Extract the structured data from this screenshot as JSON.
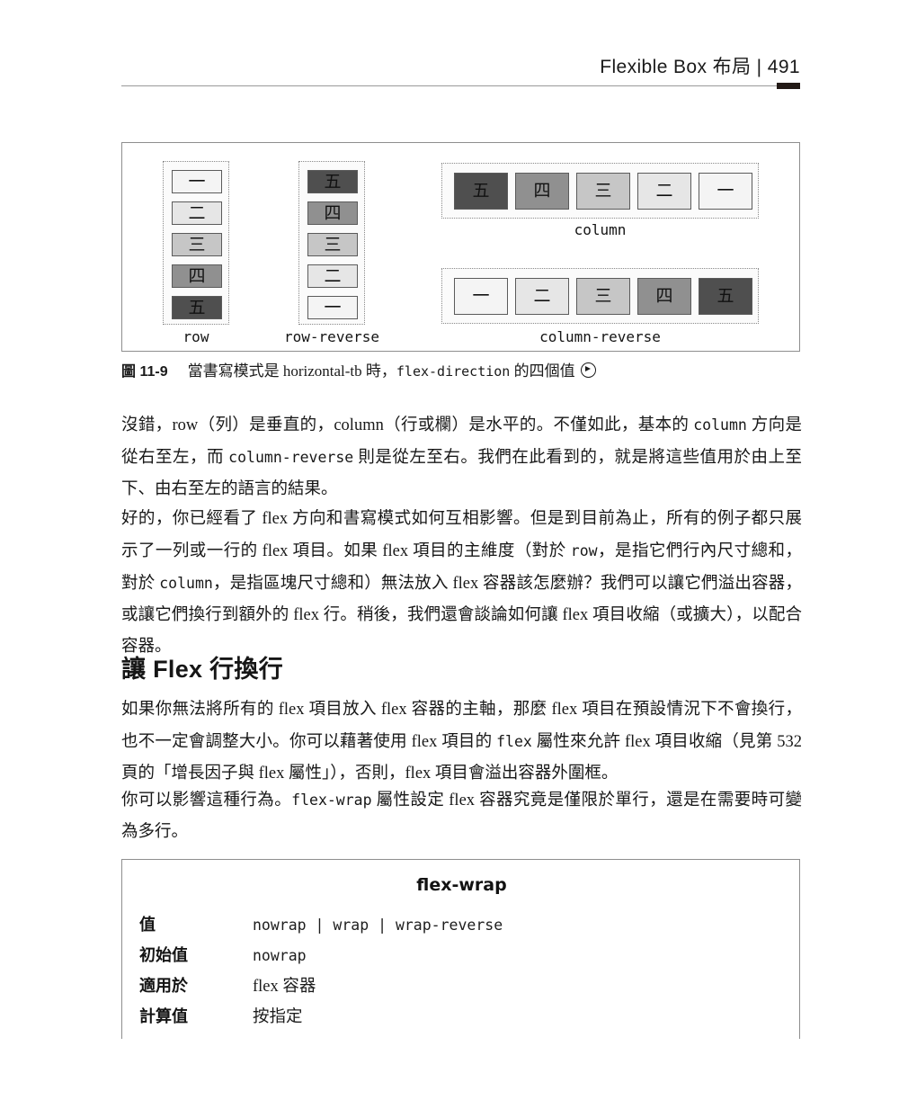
{
  "running_head": {
    "title": "Flexible Box 布局 | 491"
  },
  "figure": {
    "groups": [
      {
        "label": "row",
        "direction": "vertical",
        "items": [
          {
            "text": "一",
            "shade": "v1"
          },
          {
            "text": "二",
            "shade": "v2"
          },
          {
            "text": "三",
            "shade": "v3"
          },
          {
            "text": "四",
            "shade": "v4"
          },
          {
            "text": "五",
            "shade": "v5"
          }
        ]
      },
      {
        "label": "row-reverse",
        "direction": "vertical",
        "items": [
          {
            "text": "五",
            "shade": "v5"
          },
          {
            "text": "四",
            "shade": "v4"
          },
          {
            "text": "三",
            "shade": "v3"
          },
          {
            "text": "二",
            "shade": "v2"
          },
          {
            "text": "一",
            "shade": "v1"
          }
        ]
      },
      {
        "label": "column",
        "direction": "horizontal",
        "items": [
          {
            "text": "五",
            "shade": "v5"
          },
          {
            "text": "四",
            "shade": "v4"
          },
          {
            "text": "三",
            "shade": "v3"
          },
          {
            "text": "二",
            "shade": "v2"
          },
          {
            "text": "一",
            "shade": "v1"
          }
        ]
      },
      {
        "label": "column-reverse",
        "direction": "horizontal",
        "items": [
          {
            "text": "一",
            "shade": "v1"
          },
          {
            "text": "二",
            "shade": "v2"
          },
          {
            "text": "三",
            "shade": "v3"
          },
          {
            "text": "四",
            "shade": "v4"
          },
          {
            "text": "五",
            "shade": "v5"
          }
        ]
      }
    ],
    "shade_colors": {
      "v1": "#f4f4f4",
      "v2": "#e6e6e6",
      "v3": "#c6c6c6",
      "v4": "#909090",
      "v5": "#4f4f4f"
    }
  },
  "caption": {
    "number": "圖 11-9",
    "text_before": "當書寫模式是 horizontal-tb 時，",
    "code": "flex-direction",
    "text_after": " 的四個值",
    "icon": "play-circle-icon"
  },
  "paragraphs": {
    "p1_a": "沒錯，row（列）是垂直的，column（行或欄）是水平的。不僅如此，基本的 ",
    "p1_code1": "column",
    "p1_b": " 方向是從右至左，而 ",
    "p1_code2": "column-reverse",
    "p1_c": " 則是從左至右。我們在此看到的，就是將這些值用於由上至下、由右至左的語言的結果。",
    "p2_a": "好的，你已經看了 flex 方向和書寫模式如何互相影響。但是到目前為止，所有的例子都只展示了一列或一行的 flex 項目。如果 flex 項目的主維度（對於 ",
    "p2_code1": "row",
    "p2_b": "，是指它們行內尺寸總和，對於 ",
    "p2_code2": "column",
    "p2_c": "，是指區塊尺寸總和）無法放入 flex 容器該怎麼辦？我們可以讓它們溢出容器，或讓它們換行到額外的 flex 行。稍後，我們還會談論如何讓 flex 項目收縮（或擴大），以配合容器。",
    "p3_a": "如果你無法將所有的 flex 項目放入 flex 容器的主軸，那麼 flex 項目在預設情況下不會換行，也不一定會調整大小。你可以藉著使用 flex 項目的 ",
    "p3_code1": "flex",
    "p3_b": " 屬性來允許 flex 項目收縮（見第 532 頁的「增長因子與 flex 屬性」），否則，flex 項目會溢出容器外圍框。",
    "p4_a": "你可以影響這種行為。",
    "p4_code1": "flex-wrap",
    "p4_b": " 屬性設定 flex 容器究竟是僅限於單行，還是在需要時可變為多行。"
  },
  "heading": {
    "text": "讓 Flex 行換行"
  },
  "property_box": {
    "title": "flex-wrap",
    "rows": [
      {
        "term": "值",
        "value": "nowrap | wrap | wrap-reverse",
        "style": "mono"
      },
      {
        "term": "初始值",
        "value": "nowrap",
        "style": "mono"
      },
      {
        "term": "適用於",
        "value": "flex 容器",
        "style": "serif"
      },
      {
        "term": "計算值",
        "value": "按指定",
        "style": "serif"
      }
    ]
  }
}
